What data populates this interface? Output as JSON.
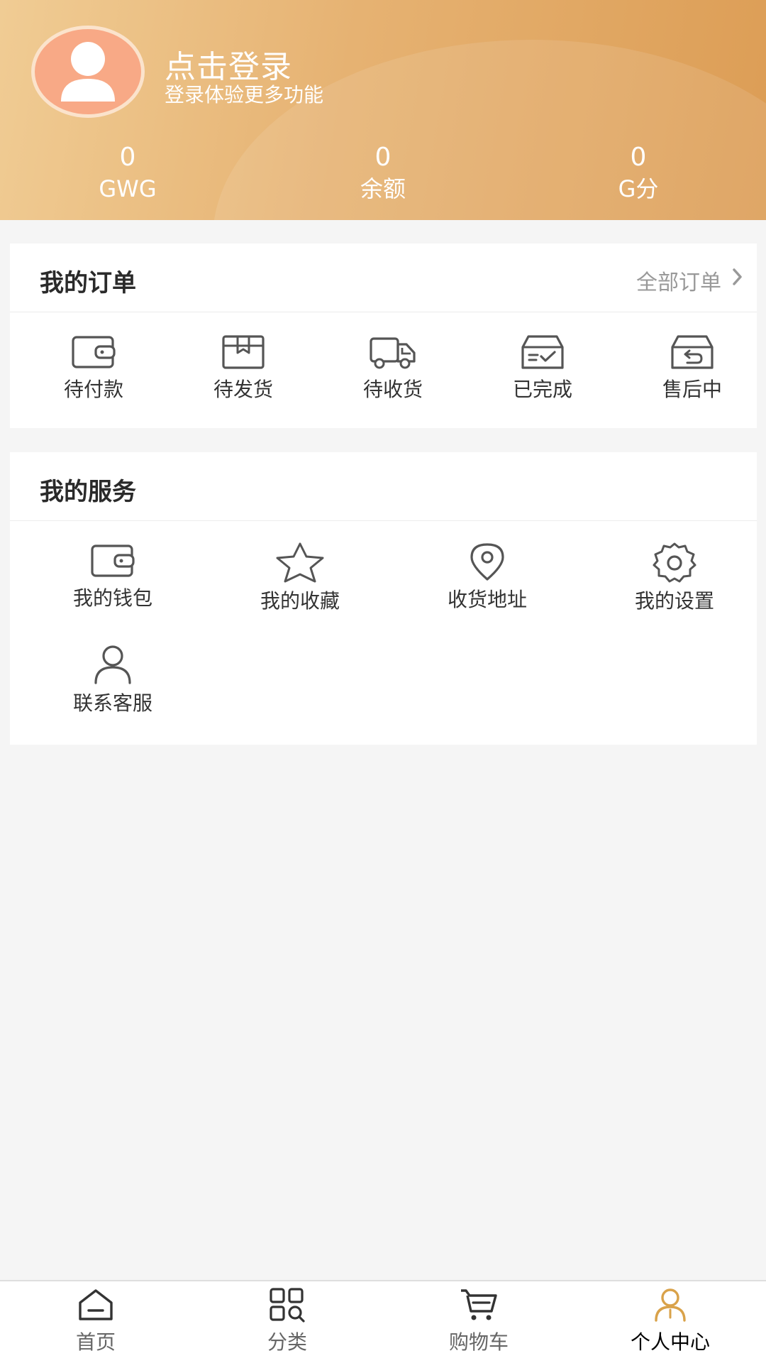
{
  "header": {
    "login_title": "点击登录",
    "login_subtitle": "登录体验更多功能",
    "stats": [
      {
        "value": "0",
        "label": "GWG"
      },
      {
        "value": "0",
        "label": "余额"
      },
      {
        "value": "0",
        "label": "G分"
      }
    ]
  },
  "orders": {
    "title": "我的订单",
    "all_link": "全部订单",
    "items": [
      {
        "label": "待付款",
        "icon": "wallet-icon"
      },
      {
        "label": "待发货",
        "icon": "package-icon"
      },
      {
        "label": "待收货",
        "icon": "truck-icon"
      },
      {
        "label": "已完成",
        "icon": "inbox-check-icon"
      },
      {
        "label": "售后中",
        "icon": "inbox-return-icon"
      }
    ]
  },
  "services": {
    "title": "我的服务",
    "items": [
      {
        "label": "我的钱包",
        "icon": "wallet-icon"
      },
      {
        "label": "我的收藏",
        "icon": "star-icon"
      },
      {
        "label": "收货地址",
        "icon": "location-icon"
      },
      {
        "label": "我的设置",
        "icon": "gear-icon"
      },
      {
        "label": "联系客服",
        "icon": "person-icon"
      }
    ]
  },
  "tabbar": {
    "active": "个人中心",
    "items": [
      {
        "label": "首页",
        "icon": "home-icon"
      },
      {
        "label": "分类",
        "icon": "grid-icon"
      },
      {
        "label": "购物车",
        "icon": "cart-icon"
      },
      {
        "label": "个人中心",
        "icon": "person-icon"
      }
    ]
  },
  "colors": {
    "header_start": "#f0cc94",
    "header_end": "#dc9d55",
    "avatar_bg": "#f8a986",
    "active_tab_icon": "#d9a24a"
  }
}
